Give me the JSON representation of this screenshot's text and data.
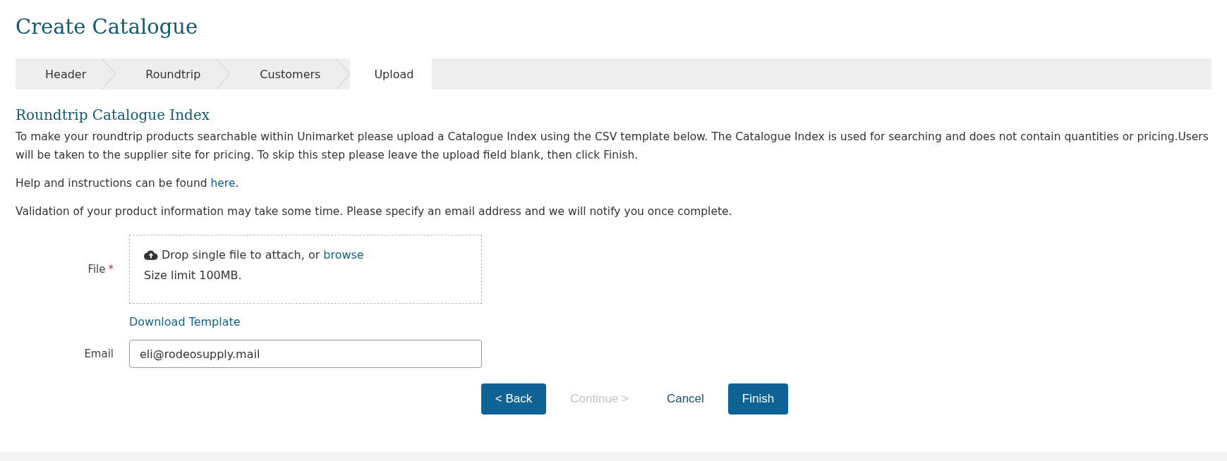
{
  "page_title": "Create Catalogue",
  "steps": [
    {
      "label": "Header",
      "selected": false
    },
    {
      "label": "Roundtrip",
      "selected": false
    },
    {
      "label": "Customers",
      "selected": false
    },
    {
      "label": "Upload",
      "selected": true
    }
  ],
  "section_title": "Roundtrip Catalogue Index",
  "intro": "To make your roundtrip products searchable within Unimarket please upload a Catalogue Index using the CSV template below. The Catalogue Index is used for searching and does not contain quantities or pricing.Users will be taken to the supplier site for pricing. To skip this step please leave the upload field blank, then click Finish.",
  "help": {
    "before": "Help and instructions can be found",
    "link": "here",
    "after": "."
  },
  "validation_note": "Validation of your product information may take some time. Please specify an email address and we will notify you once complete.",
  "file_field": {
    "label": "File",
    "required_mark": "*",
    "drop_text": "Drop single file to attach, or",
    "browse_link": "browse",
    "size_limit": "Size limit 100MB."
  },
  "download_template": "Download Template",
  "email_field": {
    "label": "Email",
    "value": "eli@rodeosupply.mail"
  },
  "buttons": [
    {
      "label": "< Back",
      "kind": "primary",
      "disabled": false
    },
    {
      "label": "Continue >",
      "kind": "link",
      "disabled": true
    },
    {
      "label": "Cancel",
      "kind": "link",
      "disabled": false
    },
    {
      "label": "Finish",
      "kind": "primary",
      "disabled": false
    }
  ]
}
